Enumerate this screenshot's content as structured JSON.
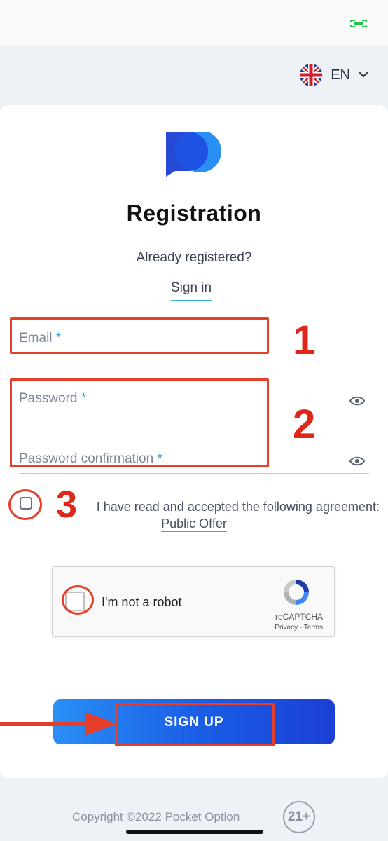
{
  "status_bar": {
    "battery_icon": "battery-icon"
  },
  "language": {
    "code": "EN",
    "flag_icon": "uk-flag-icon"
  },
  "title": "Registration",
  "already_registered": "Already registered?",
  "sign_in": "Sign in",
  "fields": {
    "email": {
      "label": "Email",
      "required_mark": "*"
    },
    "password": {
      "label": "Password",
      "required_mark": "*"
    },
    "password_confirmation": {
      "label": "Password confirmation",
      "required_mark": "*"
    }
  },
  "agreement": {
    "text": "I have read and accepted the following agreement:",
    "link": "Public Offer",
    "checked": false
  },
  "recaptcha": {
    "label": "I'm not a robot",
    "brand": "reCAPTCHA",
    "links": "Privacy - Terms"
  },
  "signup_button": "SIGN UP",
  "annotations": {
    "marker_1": "1",
    "marker_2": "2",
    "marker_3": "3",
    "color": "#e53e2b"
  },
  "footer": {
    "copyright": "Copyright ©2022 Pocket Option",
    "age_badge": "21+"
  },
  "colors": {
    "accent": "#2bb0d6",
    "button_start": "#2a8ff5",
    "button_end": "#1a3fd4",
    "logo_dark": "#1a3fd4",
    "logo_light": "#2a8ff5"
  }
}
